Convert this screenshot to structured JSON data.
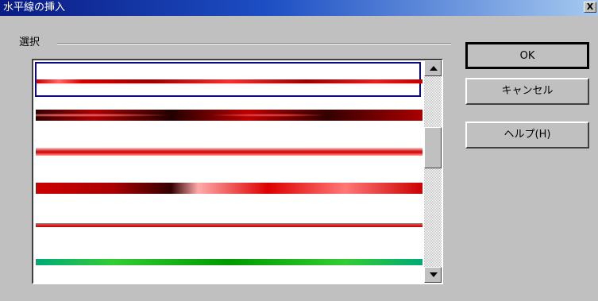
{
  "window": {
    "title": "水平線の挿入",
    "close_label": "X"
  },
  "group": {
    "label": "選択"
  },
  "list": {
    "items": [
      {
        "name": "red-line-1"
      },
      {
        "name": "dark-red-line"
      },
      {
        "name": "pink-red-line"
      },
      {
        "name": "red-gradient-line"
      },
      {
        "name": "thin-red-line"
      },
      {
        "name": "green-line"
      }
    ],
    "selected_index": 0
  },
  "buttons": {
    "ok": "OK",
    "cancel": "キャンセル",
    "help": "ヘルプ(H)"
  }
}
